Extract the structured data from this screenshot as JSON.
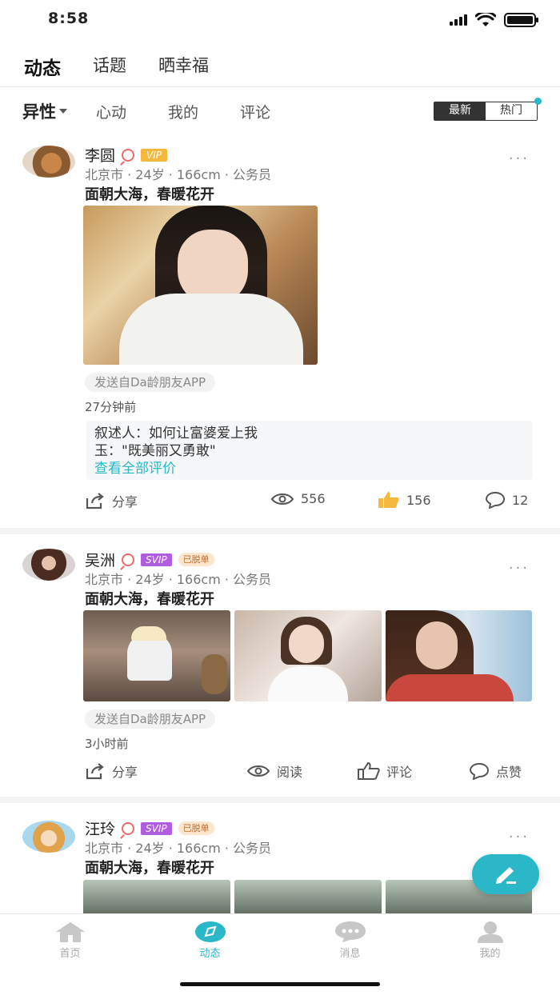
{
  "status": {
    "time": "8:58"
  },
  "top_tabs": [
    "动态",
    "话题",
    "晒幸福"
  ],
  "sub_tabs": {
    "active": "异性",
    "others": [
      "心动",
      "我的",
      "评论"
    ]
  },
  "sort": {
    "newest": "最新",
    "hot": "热门"
  },
  "posts": [
    {
      "name": "李圆",
      "badge": "VIP",
      "meta": "北京市 · 24岁 · 166cm · 公务员",
      "text": "面朝大海，春暖花开",
      "source": "发送自Da龄朋友APP",
      "time": "27分钟前",
      "comments": [
        "叙述人：如何让富婆爱上我",
        "玉：\"既美丽又勇敢\""
      ],
      "see_all": "查看全部评价",
      "share": "分享",
      "views": "556",
      "likes": "156",
      "replies": "12"
    },
    {
      "name": "吴洲",
      "badge": "SVIP",
      "tag": "已脱单",
      "meta": "北京市 · 24岁 · 166cm · 公务员",
      "text": "面朝大海，春暖花开",
      "source": "发送自Da龄朋友APP",
      "time": "3小时前",
      "share": "分享",
      "read": "阅读",
      "comment": "评论",
      "like": "点赞"
    },
    {
      "name": "汪玲",
      "badge": "SVIP",
      "tag": "已脱单",
      "meta": "北京市 · 24岁 · 166cm · 公务员",
      "text": "面朝大海，春暖花开"
    }
  ],
  "nav": [
    "首页",
    "动态",
    "消息",
    "我的"
  ],
  "colors": {
    "accent": "#2ab8c9",
    "vip": "#f5b83d",
    "svip": "#b15de0",
    "like": "#f5b83d"
  }
}
